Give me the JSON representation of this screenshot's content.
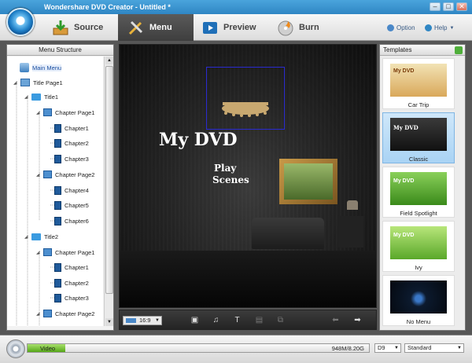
{
  "window": {
    "title": "Wondershare DVD Creator - Untitled *",
    "min": "–",
    "max": "□",
    "close": "✕"
  },
  "nav": {
    "tabs": [
      {
        "label": "Source"
      },
      {
        "label": "Menu"
      },
      {
        "label": "Preview"
      },
      {
        "label": "Burn"
      }
    ],
    "option": "Option",
    "help": "Help"
  },
  "menu_structure": {
    "header": "Menu Structure",
    "nodes": [
      {
        "label": "Main Menu"
      },
      {
        "label": "Title Page1"
      },
      {
        "label": "Title1"
      },
      {
        "label": "Chapter Page1"
      },
      {
        "label": "Chapter1"
      },
      {
        "label": "Chapter2"
      },
      {
        "label": "Chapter3"
      },
      {
        "label": "Chapter Page2"
      },
      {
        "label": "Chapter4"
      },
      {
        "label": "Chapter5"
      },
      {
        "label": "Chapter6"
      },
      {
        "label": "Title2"
      },
      {
        "label": "Chapter Page1"
      },
      {
        "label": "Chapter1"
      },
      {
        "label": "Chapter2"
      },
      {
        "label": "Chapter3"
      },
      {
        "label": "Chapter Page2"
      }
    ]
  },
  "preview": {
    "title": "My DVD",
    "play": "Play",
    "scenes": "Scenes"
  },
  "toolbar": {
    "aspect": "16:9"
  },
  "templates": {
    "header": "Templates",
    "items": [
      {
        "label": "Car Trip",
        "thumb": "My DVD"
      },
      {
        "label": "Classic",
        "thumb": "My DVD"
      },
      {
        "label": "Field Spotlight",
        "thumb": "My DVD"
      },
      {
        "label": "Ivy",
        "thumb": "My DVD"
      },
      {
        "label": "No Menu",
        "thumb": ""
      }
    ]
  },
  "status": {
    "type": "Video",
    "size": "948M/8.20G",
    "disc": "D9",
    "quality": "Standard",
    "progress_fraction": 0.11
  },
  "colors": {
    "accent": "#2f86c4",
    "progress": "#56a818"
  }
}
